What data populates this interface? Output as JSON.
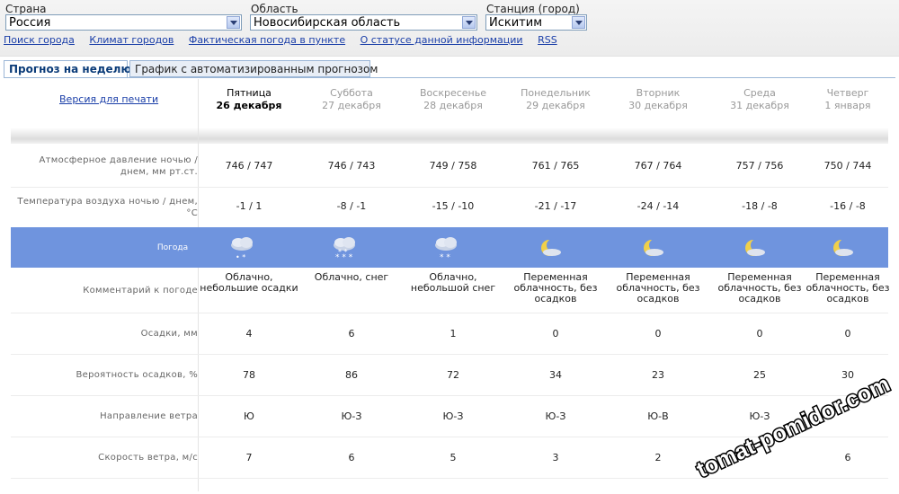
{
  "filters": {
    "country": {
      "label": "Страна",
      "value": "Россия"
    },
    "region": {
      "label": "Область",
      "value": "Новосибирская область"
    },
    "station": {
      "label": "Станция (город)",
      "value": "Искитим"
    }
  },
  "links": [
    "Поиск города",
    "Климат городов",
    "Фактическая погода в пункте",
    "О статусе данной информации",
    "RSS"
  ],
  "tabs": [
    "Прогноз на неделю",
    "График с автоматизированным прогнозом"
  ],
  "print_link": "Версия для печати",
  "days": [
    {
      "name": "Пятница",
      "date": "26 декабря"
    },
    {
      "name": "Суббота",
      "date": "27 декабря"
    },
    {
      "name": "Воскресенье",
      "date": "28 декабря"
    },
    {
      "name": "Понедельник",
      "date": "29 декабря"
    },
    {
      "name": "Вторник",
      "date": "30 декабря"
    },
    {
      "name": "Среда",
      "date": "31 декабря"
    },
    {
      "name": "Четверг",
      "date": "1 января"
    }
  ],
  "rows": {
    "pressure": {
      "label": "Атмосферное давление ночью / днем, мм рт.ст.",
      "values": [
        "746 / 747",
        "746 / 743",
        "749 / 758",
        "761 / 765",
        "767 / 764",
        "757 / 756",
        "750 / 744"
      ]
    },
    "temperature": {
      "label": "Температура воздуха ночью / днем, °C",
      "values": [
        "-1 / 1",
        "-8 / -1",
        "-15 / -10",
        "-21 / -17",
        "-24 / -14",
        "-18 / -8",
        "-16 / -8"
      ]
    },
    "comment": {
      "label": "Комментарий к погоде",
      "values": [
        "Облачно, небольшие осадки",
        "Облачно, снег",
        "Облачно, небольшой снег",
        "Переменная облачность, без осадков",
        "Переменная облачность, без осадков",
        "Переменная облачность, без осадков",
        "Переменная облачность, без осадков"
      ]
    },
    "precip": {
      "label": "Осадки, мм",
      "values": [
        "4",
        "6",
        "1",
        "0",
        "0",
        "0",
        "0"
      ]
    },
    "probability": {
      "label": "Вероятность осадков, %",
      "values": [
        "78",
        "86",
        "72",
        "34",
        "23",
        "25",
        "30"
      ]
    },
    "wind_dir": {
      "label": "Направление ветра",
      "values": [
        "Ю",
        "Ю-З",
        "Ю-З",
        "Ю-З",
        "Ю-В",
        "Ю-З",
        ""
      ]
    },
    "wind_speed": {
      "label": "Скорость ветра, м/с",
      "values": [
        "7",
        "6",
        "5",
        "3",
        "2",
        "",
        "6"
      ]
    }
  },
  "weather_label": "Погода",
  "weather_icons": [
    "cloud-light-precip-icon",
    "cloud-snow-icon",
    "cloud-light-snow-icon",
    "moon-cloud-icon",
    "moon-cloud-icon",
    "moon-cloud-icon",
    "moon-cloud-icon"
  ],
  "watermark": "tomat-pomidor.com",
  "colors": {
    "weather_band": "#6f94de",
    "link": "#1a3ea8"
  }
}
